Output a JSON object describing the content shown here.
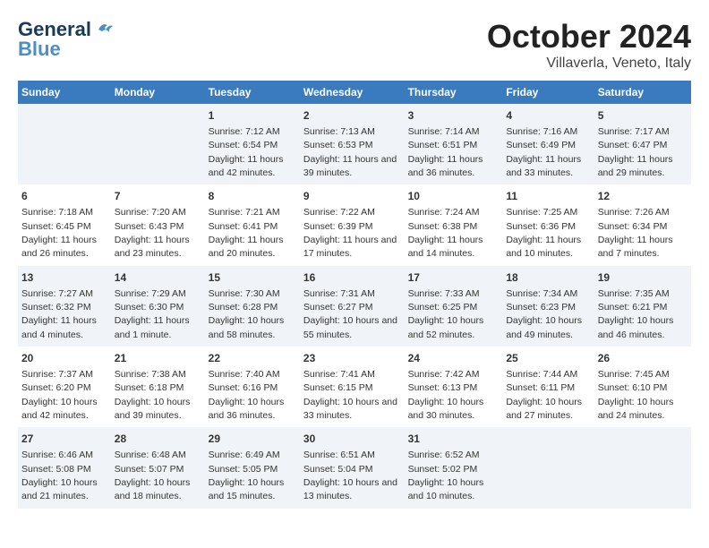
{
  "header": {
    "logo_line1": "General",
    "logo_line2": "Blue",
    "month": "October 2024",
    "location": "Villaverla, Veneto, Italy"
  },
  "weekdays": [
    "Sunday",
    "Monday",
    "Tuesday",
    "Wednesday",
    "Thursday",
    "Friday",
    "Saturday"
  ],
  "weeks": [
    [
      {
        "day": "",
        "info": ""
      },
      {
        "day": "",
        "info": ""
      },
      {
        "day": "1",
        "info": "Sunrise: 7:12 AM\nSunset: 6:54 PM\nDaylight: 11 hours and 42 minutes."
      },
      {
        "day": "2",
        "info": "Sunrise: 7:13 AM\nSunset: 6:53 PM\nDaylight: 11 hours and 39 minutes."
      },
      {
        "day": "3",
        "info": "Sunrise: 7:14 AM\nSunset: 6:51 PM\nDaylight: 11 hours and 36 minutes."
      },
      {
        "day": "4",
        "info": "Sunrise: 7:16 AM\nSunset: 6:49 PM\nDaylight: 11 hours and 33 minutes."
      },
      {
        "day": "5",
        "info": "Sunrise: 7:17 AM\nSunset: 6:47 PM\nDaylight: 11 hours and 29 minutes."
      }
    ],
    [
      {
        "day": "6",
        "info": "Sunrise: 7:18 AM\nSunset: 6:45 PM\nDaylight: 11 hours and 26 minutes."
      },
      {
        "day": "7",
        "info": "Sunrise: 7:20 AM\nSunset: 6:43 PM\nDaylight: 11 hours and 23 minutes."
      },
      {
        "day": "8",
        "info": "Sunrise: 7:21 AM\nSunset: 6:41 PM\nDaylight: 11 hours and 20 minutes."
      },
      {
        "day": "9",
        "info": "Sunrise: 7:22 AM\nSunset: 6:39 PM\nDaylight: 11 hours and 17 minutes."
      },
      {
        "day": "10",
        "info": "Sunrise: 7:24 AM\nSunset: 6:38 PM\nDaylight: 11 hours and 14 minutes."
      },
      {
        "day": "11",
        "info": "Sunrise: 7:25 AM\nSunset: 6:36 PM\nDaylight: 11 hours and 10 minutes."
      },
      {
        "day": "12",
        "info": "Sunrise: 7:26 AM\nSunset: 6:34 PM\nDaylight: 11 hours and 7 minutes."
      }
    ],
    [
      {
        "day": "13",
        "info": "Sunrise: 7:27 AM\nSunset: 6:32 PM\nDaylight: 11 hours and 4 minutes."
      },
      {
        "day": "14",
        "info": "Sunrise: 7:29 AM\nSunset: 6:30 PM\nDaylight: 11 hours and 1 minute."
      },
      {
        "day": "15",
        "info": "Sunrise: 7:30 AM\nSunset: 6:28 PM\nDaylight: 10 hours and 58 minutes."
      },
      {
        "day": "16",
        "info": "Sunrise: 7:31 AM\nSunset: 6:27 PM\nDaylight: 10 hours and 55 minutes."
      },
      {
        "day": "17",
        "info": "Sunrise: 7:33 AM\nSunset: 6:25 PM\nDaylight: 10 hours and 52 minutes."
      },
      {
        "day": "18",
        "info": "Sunrise: 7:34 AM\nSunset: 6:23 PM\nDaylight: 10 hours and 49 minutes."
      },
      {
        "day": "19",
        "info": "Sunrise: 7:35 AM\nSunset: 6:21 PM\nDaylight: 10 hours and 46 minutes."
      }
    ],
    [
      {
        "day": "20",
        "info": "Sunrise: 7:37 AM\nSunset: 6:20 PM\nDaylight: 10 hours and 42 minutes."
      },
      {
        "day": "21",
        "info": "Sunrise: 7:38 AM\nSunset: 6:18 PM\nDaylight: 10 hours and 39 minutes."
      },
      {
        "day": "22",
        "info": "Sunrise: 7:40 AM\nSunset: 6:16 PM\nDaylight: 10 hours and 36 minutes."
      },
      {
        "day": "23",
        "info": "Sunrise: 7:41 AM\nSunset: 6:15 PM\nDaylight: 10 hours and 33 minutes."
      },
      {
        "day": "24",
        "info": "Sunrise: 7:42 AM\nSunset: 6:13 PM\nDaylight: 10 hours and 30 minutes."
      },
      {
        "day": "25",
        "info": "Sunrise: 7:44 AM\nSunset: 6:11 PM\nDaylight: 10 hours and 27 minutes."
      },
      {
        "day": "26",
        "info": "Sunrise: 7:45 AM\nSunset: 6:10 PM\nDaylight: 10 hours and 24 minutes."
      }
    ],
    [
      {
        "day": "27",
        "info": "Sunrise: 6:46 AM\nSunset: 5:08 PM\nDaylight: 10 hours and 21 minutes."
      },
      {
        "day": "28",
        "info": "Sunrise: 6:48 AM\nSunset: 5:07 PM\nDaylight: 10 hours and 18 minutes."
      },
      {
        "day": "29",
        "info": "Sunrise: 6:49 AM\nSunset: 5:05 PM\nDaylight: 10 hours and 15 minutes."
      },
      {
        "day": "30",
        "info": "Sunrise: 6:51 AM\nSunset: 5:04 PM\nDaylight: 10 hours and 13 minutes."
      },
      {
        "day": "31",
        "info": "Sunrise: 6:52 AM\nSunset: 5:02 PM\nDaylight: 10 hours and 10 minutes."
      },
      {
        "day": "",
        "info": ""
      },
      {
        "day": "",
        "info": ""
      }
    ]
  ]
}
